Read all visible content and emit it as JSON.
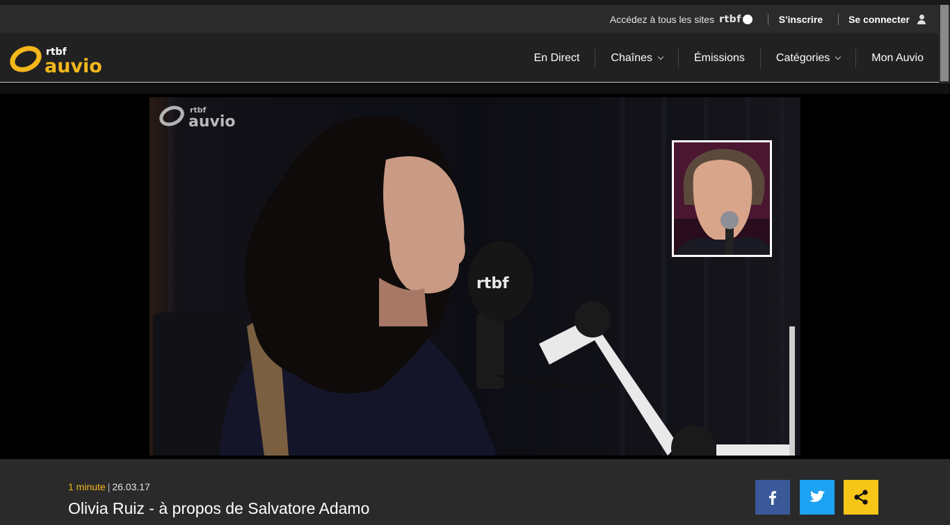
{
  "topbar": {
    "access_text": "Accédez à tous les sites",
    "brand_small": "rtbf",
    "register_label": "S'inscrire",
    "login_label": "Se connecter"
  },
  "logo": {
    "top": "rtbf",
    "bottom": "auvio"
  },
  "menu": {
    "items": [
      {
        "label": "En Direct",
        "dropdown": false
      },
      {
        "label": "Chaînes",
        "dropdown": true
      },
      {
        "label": "Émissions",
        "dropdown": false
      },
      {
        "label": "Catégories",
        "dropdown": true
      },
      {
        "label": "Mon Auvio",
        "dropdown": false
      }
    ]
  },
  "video": {
    "watermark_top": "rtbf",
    "watermark_bottom": "auvio",
    "mic_brand": "rtbf"
  },
  "info": {
    "duration": "1 minute",
    "date": "26.03.17",
    "title": "Olivia Ruiz - à propos de Salvatore Adamo"
  },
  "share": {
    "facebook_icon": "facebook-icon",
    "twitter_icon": "twitter-icon",
    "share_icon": "share-icon"
  },
  "colors": {
    "accent": "#f4b71b",
    "facebook": "#3b5998",
    "twitter": "#1da1f2",
    "share": "#f5c518"
  }
}
